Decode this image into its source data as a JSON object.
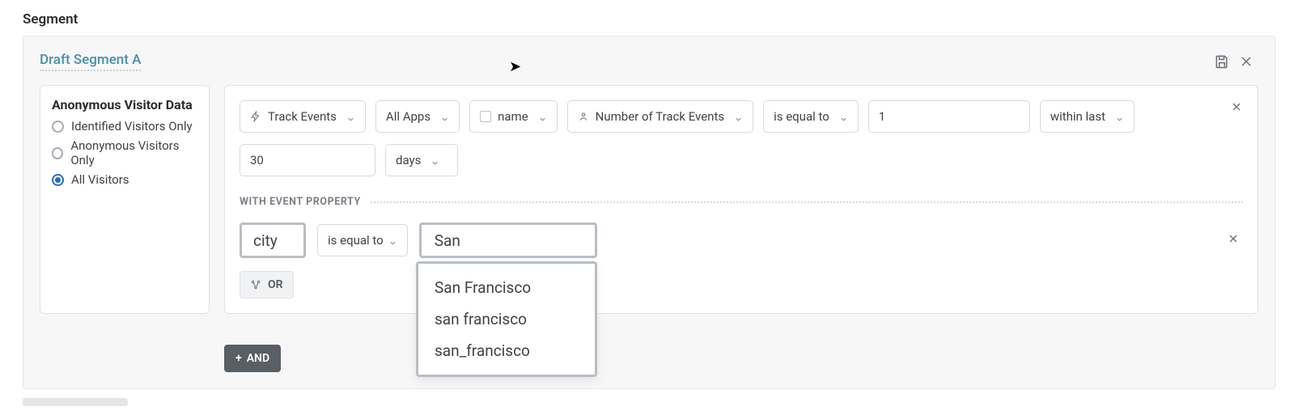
{
  "header": {
    "title": "Segment"
  },
  "segment": {
    "title": "Draft Segment A"
  },
  "sidebar": {
    "title": "Anonymous Visitor Data",
    "options": [
      {
        "label": "Identified Visitors Only",
        "selected": false
      },
      {
        "label": "Anonymous Visitors Only",
        "selected": false
      },
      {
        "label": "All Visitors",
        "selected": true
      }
    ]
  },
  "rule": {
    "event_type": "Track Events",
    "app_scope": "All Apps",
    "property_slot": "name",
    "metric": "Number of Track Events",
    "comparator": "is equal to",
    "value": "1",
    "range_pref": "within last",
    "range_value": "30",
    "range_unit": "days"
  },
  "filter_section": {
    "label": "WITH EVENT PROPERTY"
  },
  "property_filter": {
    "property": "city",
    "operator": "is equal to",
    "value": "San",
    "suggestions": [
      "San Francisco",
      "san francisco",
      "san_francisco"
    ]
  },
  "buttons": {
    "or": "OR",
    "and": "AND"
  }
}
